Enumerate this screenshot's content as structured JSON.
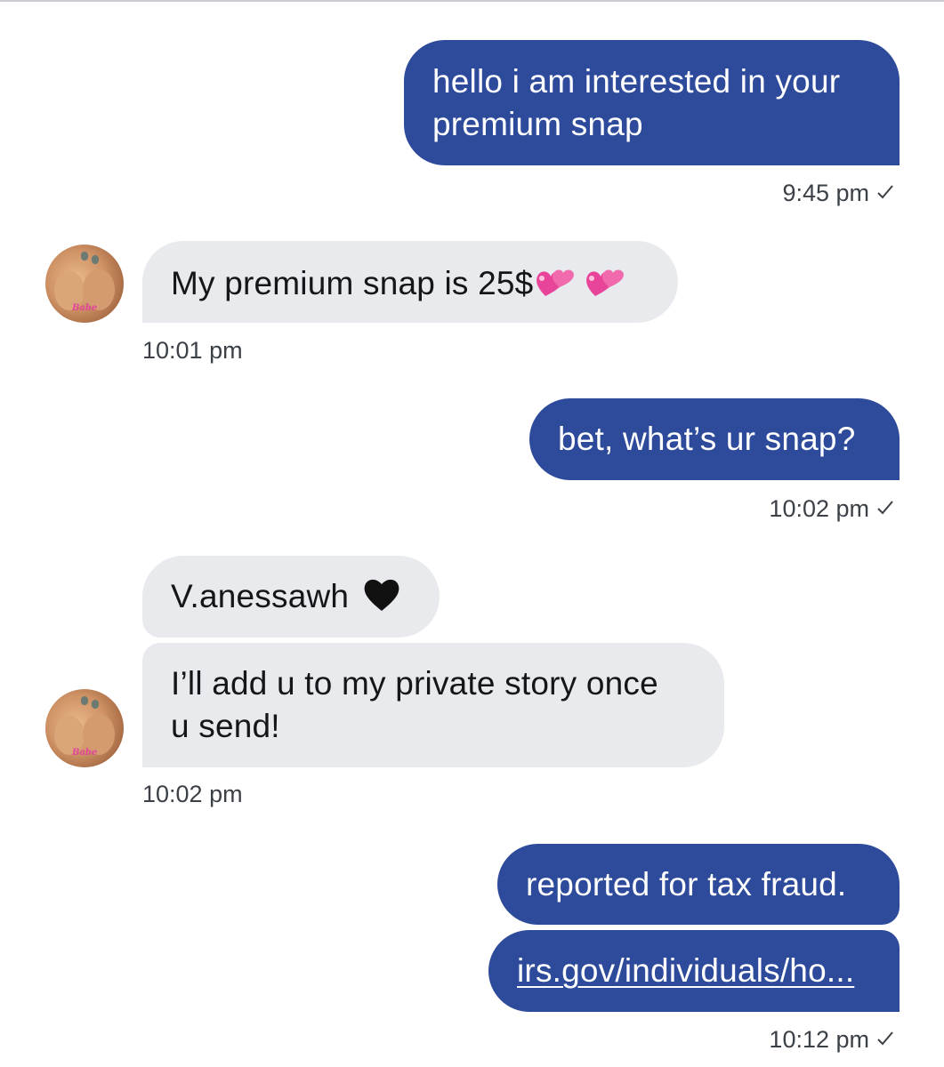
{
  "messages": [
    {
      "id": "m1",
      "direction": "outgoing",
      "text_lines": [
        "hello i am interested in your",
        "premium snap"
      ],
      "time": "9:45 pm"
    },
    {
      "id": "m2",
      "direction": "incoming",
      "text": "My premium snap is 25$",
      "emoji": [
        "two-hearts",
        "two-hearts"
      ],
      "time": "10:01 pm"
    },
    {
      "id": "m3",
      "direction": "outgoing",
      "text": "bet, what’s ur snap?",
      "time": "10:02 pm"
    },
    {
      "id": "m4",
      "direction": "incoming",
      "text": "V.anessawh",
      "emoji": [
        "black-heart"
      ]
    },
    {
      "id": "m5",
      "direction": "incoming",
      "text_lines": [
        "I’ll add u to my private story once",
        "u send!"
      ],
      "time": "10:02 pm"
    },
    {
      "id": "m6",
      "direction": "outgoing",
      "text": "reported for tax fraud."
    },
    {
      "id": "m7",
      "direction": "outgoing",
      "link": "irs.gov/individuals/ho...",
      "time": "10:12 pm"
    }
  ],
  "avatar": {
    "tag": "Babe"
  },
  "colors": {
    "outgoing_bubble": "#2d4a9b",
    "incoming_bubble": "#e8eaee",
    "timestamp": "#3c4148",
    "heart_pink": "#e8459a",
    "heart_black": "#111111"
  },
  "icons": {
    "read_receipt": "check-icon",
    "reaction": "two-hearts-emoji",
    "black_heart": "black-heart-emoji"
  }
}
